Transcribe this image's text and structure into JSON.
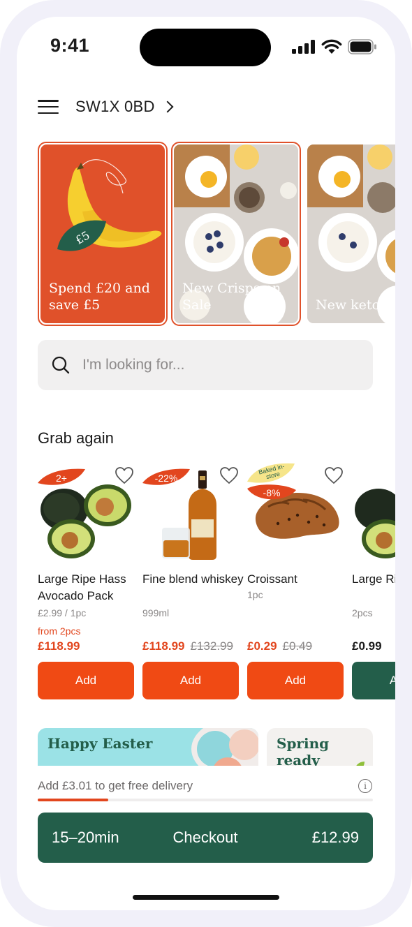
{
  "status_bar": {
    "time": "9:41"
  },
  "header": {
    "postcode": "SW1X 0BD"
  },
  "promos": [
    {
      "label": "Spend £20 and save £5",
      "tag_text": "£5"
    },
    {
      "label": "New Crisps on Sale"
    },
    {
      "label": "New ketchu"
    }
  ],
  "search": {
    "placeholder": "I'm looking for..."
  },
  "grab_again": {
    "title": "Grab again",
    "products": [
      {
        "badge": "2+",
        "name": "Large Ripe Hass Avocado Pack",
        "meta": "£2.99 / 1pc",
        "from": "from 2pcs",
        "price": "£118.99",
        "old_price": "",
        "button": "Add"
      },
      {
        "badge": "-22%",
        "name": "Fine blend whiskey",
        "meta": "999ml",
        "from": "",
        "price": "£118.99",
        "old_price": "£132.99",
        "button": "Add"
      },
      {
        "badge": "-8%",
        "sticker": "Baked in-store",
        "name": "Croissant",
        "meta": "1pc",
        "from": "",
        "price": "£0.29",
        "old_price": "£0.49",
        "button": "Add"
      },
      {
        "badge": "",
        "name": "Large Ripe Hass Avocado Pack",
        "meta": "2pcs",
        "from": "",
        "price": "£0.99",
        "old_price": "",
        "button": "Add"
      }
    ]
  },
  "banners": [
    {
      "title": "Happy Easter"
    },
    {
      "title": "Spring ready"
    }
  ],
  "delivery": {
    "text": "Add £3.01 to get free delivery",
    "progress": 0.21
  },
  "checkout": {
    "eta": "15–20min",
    "label": "Checkout",
    "total": "£12.99"
  },
  "colors": {
    "accent": "#f04a14",
    "brand_green": "#235e4a",
    "promo_orange": "#e0512a"
  }
}
